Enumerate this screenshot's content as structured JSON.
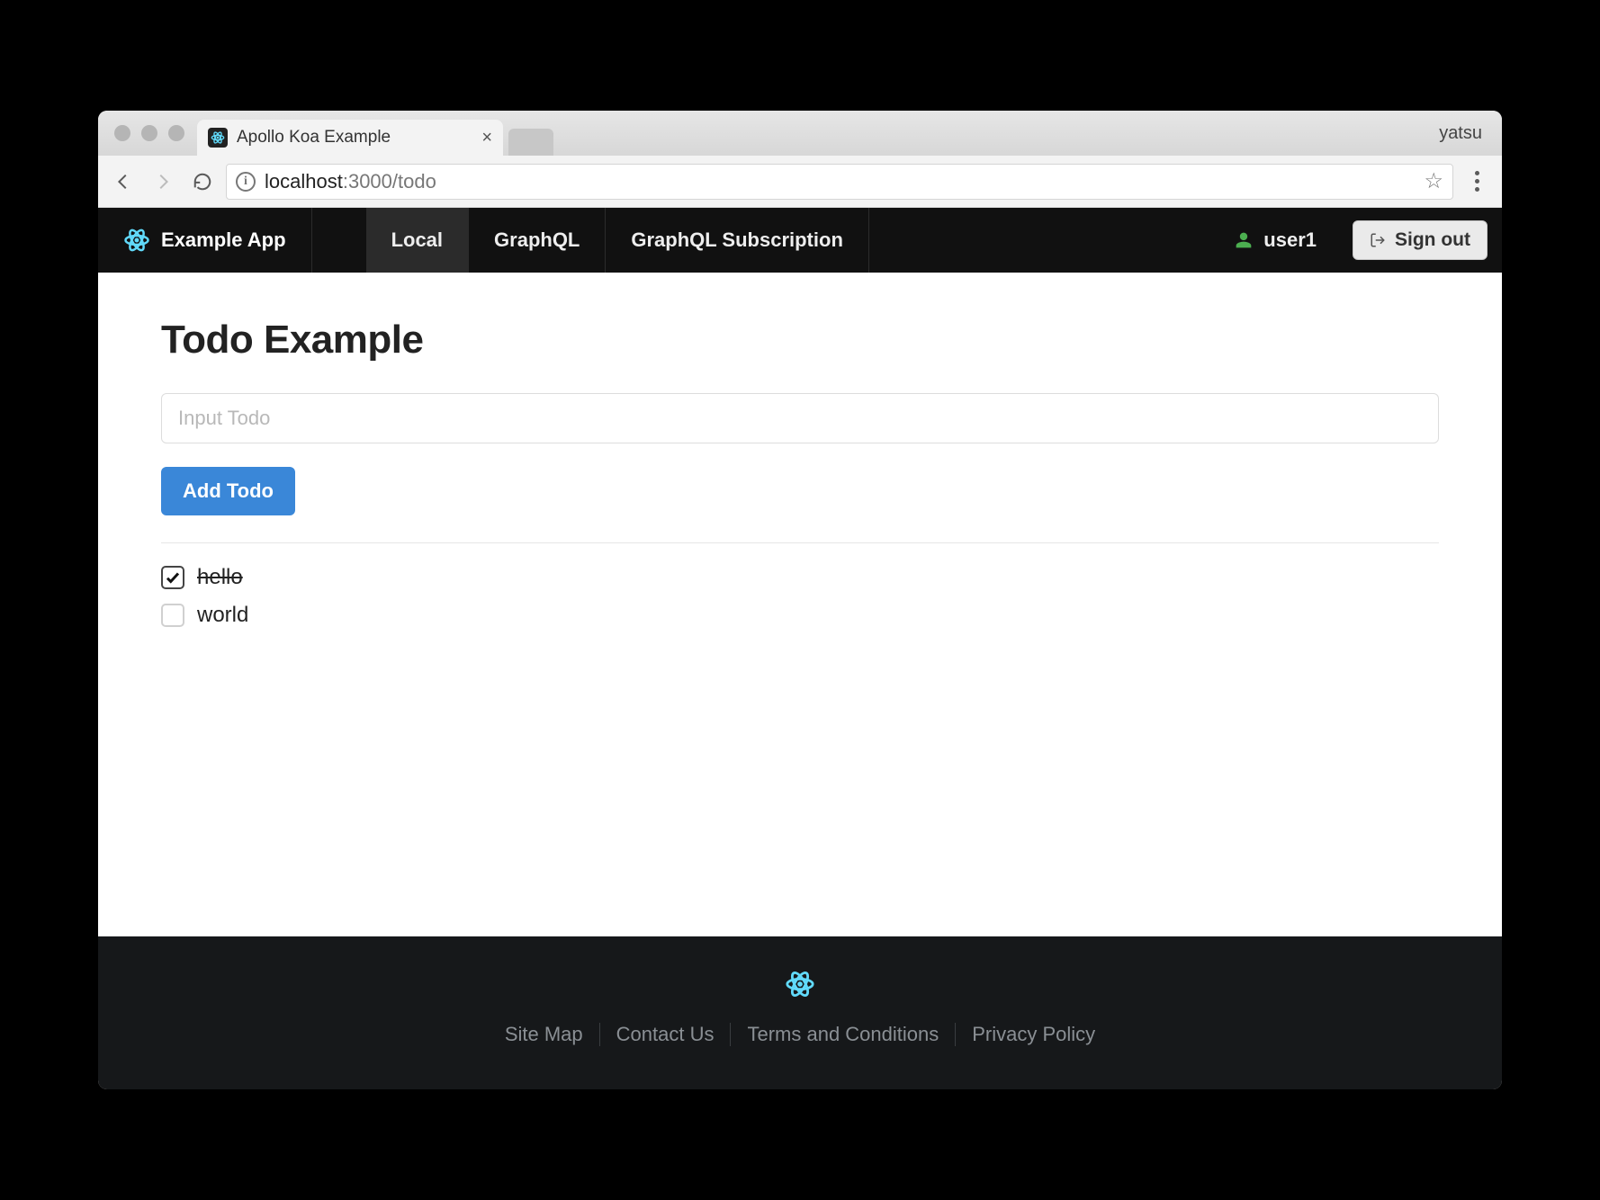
{
  "browser": {
    "tab_title": "Apollo Koa Example",
    "profile": "yatsu",
    "url_host": "localhost",
    "url_rest": ":3000/todo"
  },
  "navbar": {
    "brand": "Example App",
    "items": [
      {
        "label": "Local",
        "active": true
      },
      {
        "label": "GraphQL",
        "active": false
      },
      {
        "label": "GraphQL Subscription",
        "active": false
      }
    ],
    "username": "user1",
    "signout_label": "Sign out"
  },
  "page": {
    "heading": "Todo Example",
    "input_placeholder": "Input Todo",
    "add_button": "Add Todo",
    "todos": [
      {
        "text": "hello",
        "done": true
      },
      {
        "text": "world",
        "done": false
      }
    ]
  },
  "footer": {
    "links": [
      "Site Map",
      "Contact Us",
      "Terms and Conditions",
      "Privacy Policy"
    ]
  }
}
